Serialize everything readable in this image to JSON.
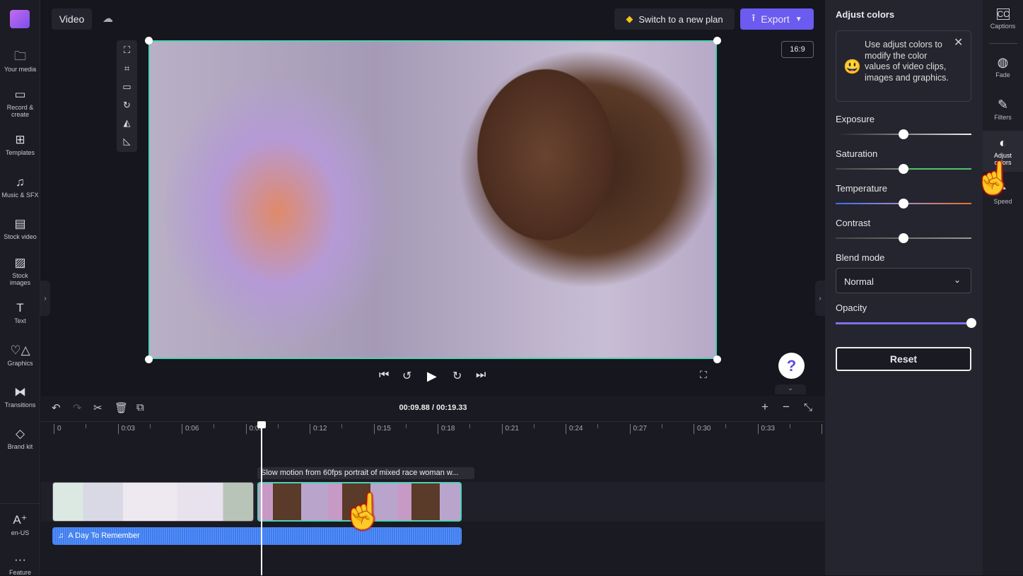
{
  "sidebar": {
    "items": [
      {
        "label": "Your media",
        "icon": "folder-icon"
      },
      {
        "label": "Record & create",
        "icon": "camera-icon"
      },
      {
        "label": "Templates",
        "icon": "templates-icon"
      },
      {
        "label": "Music & SFX",
        "icon": "music-icon"
      },
      {
        "label": "Stock video",
        "icon": "film-icon"
      },
      {
        "label": "Stock images",
        "icon": "image-icon"
      },
      {
        "label": "Text",
        "icon": "text-icon"
      },
      {
        "label": "Graphics",
        "icon": "shapes-icon"
      },
      {
        "label": "Transitions",
        "icon": "transitions-icon"
      },
      {
        "label": "Brand kit",
        "icon": "brand-kit-icon"
      }
    ],
    "language": "en-US",
    "feature": "Feature"
  },
  "header": {
    "project_name": "Video",
    "upgrade_label": "Switch to a new plan",
    "export_label": "Export",
    "aspect_ratio": "16:9"
  },
  "playback": {
    "current": "00:09.88",
    "total": "00:19.33",
    "separator": "/"
  },
  "timeline": {
    "ticks": [
      "0",
      "0:03",
      "0:06",
      "0:09",
      "0:12",
      "0:15",
      "0:18",
      "0:21",
      "0:24",
      "0:27",
      "0:30",
      "0:33",
      "0"
    ],
    "clip_tooltip": "Slow motion from 60fps portrait of mixed race woman w...",
    "audio_label": "A Day To Remember"
  },
  "panel": {
    "title": "Adjust colors",
    "tip": "Use adjust colors to modify the color values of video clips, images and graphics.",
    "sliders": [
      {
        "label": "Exposure",
        "value": 50
      },
      {
        "label": "Saturation",
        "value": 50
      },
      {
        "label": "Temperature",
        "value": 50
      },
      {
        "label": "Contrast",
        "value": 50
      }
    ],
    "blend_label": "Blend mode",
    "blend_value": "Normal",
    "opacity_label": "Opacity",
    "opacity_value": 100,
    "reset_label": "Reset"
  },
  "right_tabs": [
    {
      "label": "Captions"
    },
    {
      "label": "Fade"
    },
    {
      "label": "Filters"
    },
    {
      "label": "Adjust colors",
      "active": true
    },
    {
      "label": "Speed"
    }
  ],
  "colors": {
    "accent": "#6b5bf0",
    "selection": "#4fd1b5",
    "audio": "#3d7cf0"
  }
}
